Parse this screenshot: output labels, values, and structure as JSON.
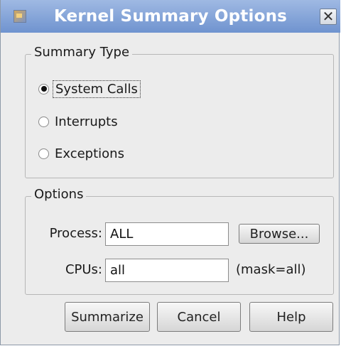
{
  "window": {
    "title": "Kernel Summary Options",
    "close_glyph": "✕"
  },
  "summary_type": {
    "legend": "Summary Type",
    "options": [
      {
        "label": "System Calls",
        "checked": true
      },
      {
        "label": "Interrupts",
        "checked": false
      },
      {
        "label": "Exceptions",
        "checked": false
      }
    ]
  },
  "options": {
    "legend": "Options",
    "process_label": "Process:",
    "process_value": "ALL",
    "browse_label": "Browse...",
    "cpus_label": "CPUs:",
    "cpus_value": "all",
    "mask_text": "(mask=all)"
  },
  "buttons": {
    "summarize": "Summarize",
    "cancel": "Cancel",
    "help": "Help"
  }
}
